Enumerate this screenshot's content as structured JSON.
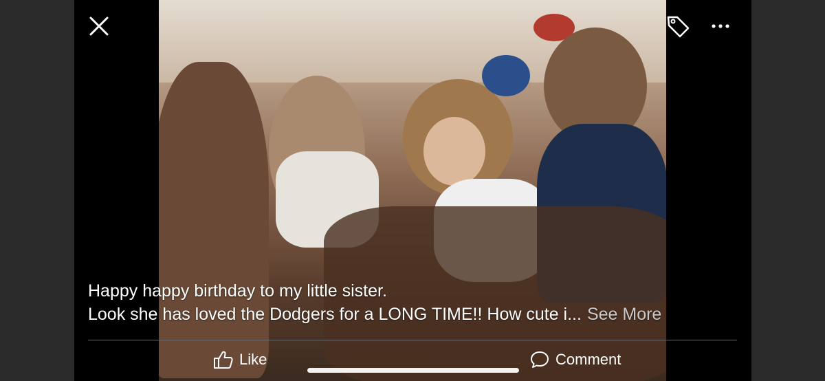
{
  "post": {
    "caption_line1": "Happy happy birthday to my little sister.",
    "caption_line2": "Look she has loved the Dodgers for a LONG TIME!!  How cute i...",
    "see_more": "See More"
  },
  "actions": {
    "like_label": "Like",
    "comment_label": "Comment"
  },
  "icons": {
    "close": "close-icon",
    "tag": "tag-icon",
    "more": "more-dots-icon",
    "like": "thumbs-up-icon",
    "comment": "comment-bubble-icon"
  },
  "colors": {
    "background": "#000000",
    "text": "#ffffff",
    "see_more": "#c9c9c9"
  }
}
